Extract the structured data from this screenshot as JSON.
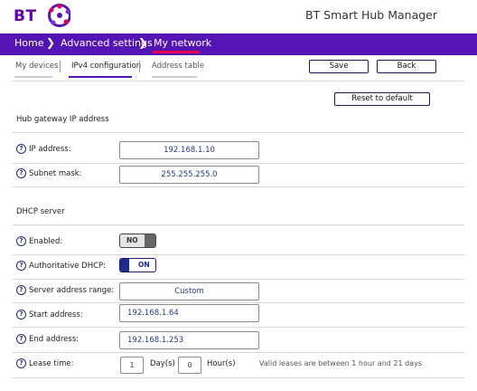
{
  "header": {
    "logo_text": "BT",
    "app_title": "BT Smart Hub Manager"
  },
  "nav": {
    "items": [
      {
        "label": "Home"
      },
      {
        "label": "Advanced settings"
      },
      {
        "label": "My network"
      }
    ],
    "accent": "#5514b4",
    "active_color": "#e60050"
  },
  "tabs": {
    "items": [
      {
        "label": "My devices"
      },
      {
        "label": "IPv4 configuration"
      },
      {
        "label": "Address table"
      }
    ],
    "active": "IPv4 configuration"
  },
  "actions": {
    "save": "Save",
    "back": "Back",
    "reset": "Reset to default"
  },
  "gateway": {
    "title": "Hub gateway IP address",
    "ip_label": "IP address:",
    "ip_value": "192.168.1.10",
    "mask_label": "Subnet mask:",
    "mask_value": "255.255.255.0"
  },
  "dhcp": {
    "title": "DHCP server",
    "enabled_label": "Enabled:",
    "enabled_value": "NO",
    "auth_label": "Authoritative DHCP:",
    "auth_value": "ON",
    "range_label": "Server address range:",
    "range_value": "Custom",
    "start_label": "Start address:",
    "start_value": "192.168.1.64",
    "end_label": "End address:",
    "end_value": "192.168.1.253",
    "lease_label": "Lease time:",
    "lease_days": "1",
    "days_unit": "Day(s)",
    "lease_hours": "0",
    "hours_unit": "Hour(s)",
    "lease_note": "Valid leases are between 1 hour and 21 days"
  },
  "icons": {
    "help": "help-icon",
    "chevron": "chevron-right-icon"
  }
}
